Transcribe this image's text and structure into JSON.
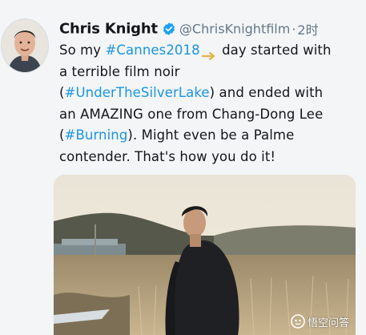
{
  "tweet": {
    "author": {
      "name": "Chris Knight",
      "handle": "@ChrisKnightfilm",
      "separator": "·",
      "time": "2时",
      "verified": true
    },
    "text": {
      "l1_a": "So my ",
      "l1_tag": "#Cannes2018",
      "l1_b": " day started with",
      "l2": "a terrible film noir",
      "l3_open": "(",
      "l3_tag": "#UnderTheSilverLake",
      "l3_b": ") and ended with",
      "l4": "an AMAZING one from Chang-Dong Lee",
      "l5_open": "(",
      "l5_tag": "#Burning",
      "l5_b": "). Might even be a Palme",
      "l6": "contender. That's how you do it!"
    }
  },
  "watermark": {
    "label": "悟空问答"
  },
  "colors": {
    "link": "#1b95e0",
    "secondary": "#657786",
    "verified": "#1da1f2"
  },
  "icons": {
    "verified": "verified-badge-icon",
    "emoji": "arrow-right-emoji",
    "watermark": "wukong-answers-logo-icon"
  }
}
